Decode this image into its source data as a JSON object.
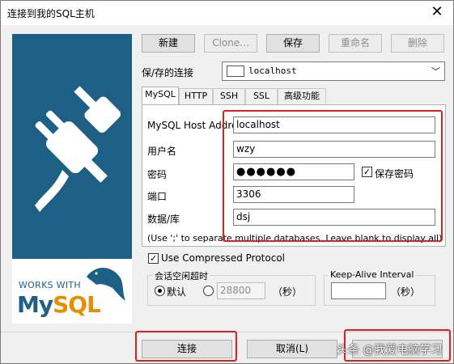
{
  "window": {
    "title": "连接到我的SQL主机",
    "close_glyph": "✕"
  },
  "toolbar": {
    "new_label": "新建",
    "clone_label": "Clone...",
    "save_label": "保存",
    "rename_label": "重命名",
    "delete_label": "删除"
  },
  "connection": {
    "label": "保/存的连接",
    "selected": "localhost"
  },
  "tabs": [
    "MySQL",
    "HTTP",
    "SSH",
    "SSL",
    "高级功能"
  ],
  "fields": {
    "host_label": "MySQL Host Address",
    "host_value": "localhost",
    "user_label": "用户名",
    "user_value": "wzy",
    "password_label": "密码",
    "password_value": "●●●●●●",
    "save_password_label": "保存密码",
    "port_label": "端口",
    "port_value": "3306",
    "database_label": "数据/库",
    "database_value": "dsj",
    "database_hint": "(Use ';' to separate multiple databases. Leave blank to display all)"
  },
  "options": {
    "compressed_label": "Use Compressed Protocol",
    "session_timeout_label": "会话空闲超时",
    "default_label": "默认",
    "timeout_value": "28800",
    "seconds_label": "（秒）",
    "keepalive_label": "Keep-Alive Interval",
    "keepalive_value": "",
    "keepalive_seconds": "（秒）"
  },
  "branding": {
    "works_with": "WORKS WITH",
    "my": "My",
    "sql": "SQL"
  },
  "footer": {
    "connect_label": "连接",
    "cancel_label": "取消(L)"
  },
  "watermark": "头条 @我爱电脑学习",
  "colors": {
    "brand_blue": "#1e5f86",
    "mysql_orange": "#e48e00",
    "highlight_red": "#e0201c"
  }
}
